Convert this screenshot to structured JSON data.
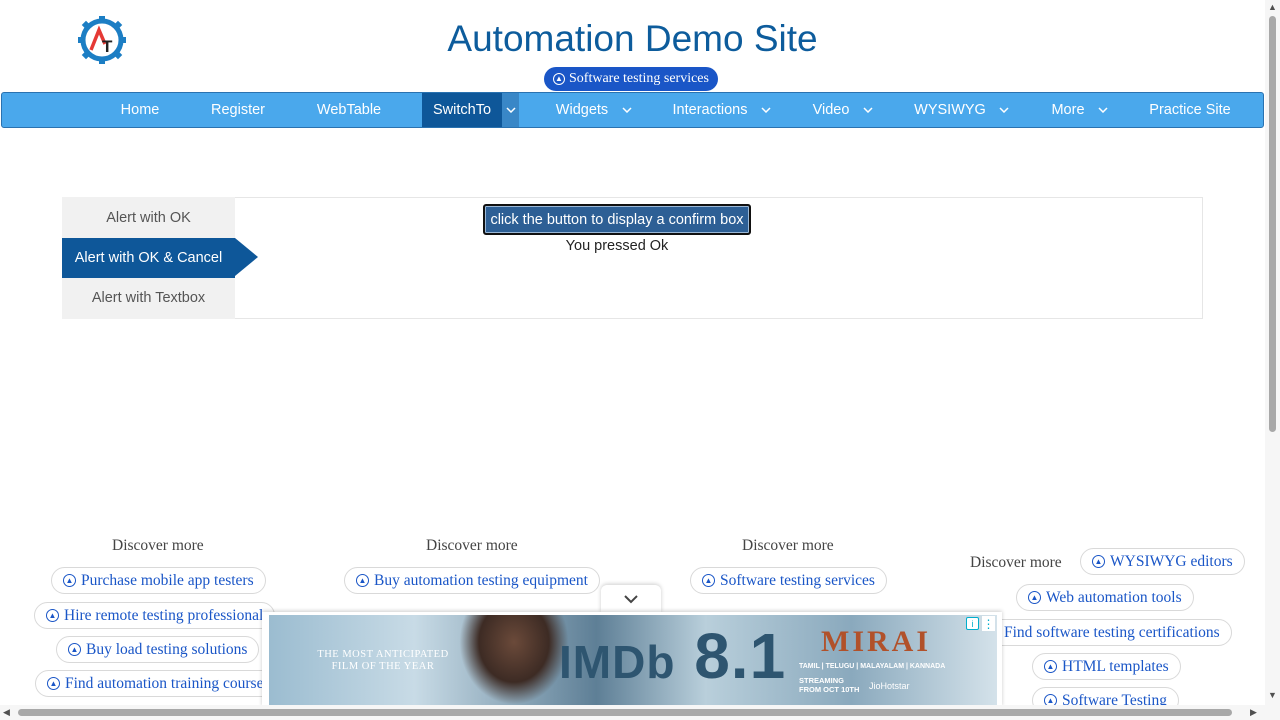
{
  "header": {
    "title": "Automation Demo Site",
    "services_pill": "Software testing services",
    "logo_letters": "AT"
  },
  "nav": {
    "items": [
      {
        "label": "Home",
        "has_dropdown": false,
        "active": false
      },
      {
        "label": "Register",
        "has_dropdown": false,
        "active": false
      },
      {
        "label": "WebTable",
        "has_dropdown": false,
        "active": false
      },
      {
        "label": "SwitchTo",
        "has_dropdown": true,
        "active": true
      },
      {
        "label": "Widgets",
        "has_dropdown": true,
        "active": false
      },
      {
        "label": "Interactions",
        "has_dropdown": true,
        "active": false
      },
      {
        "label": "Video",
        "has_dropdown": true,
        "active": false
      },
      {
        "label": "WYSIWYG",
        "has_dropdown": true,
        "active": false
      },
      {
        "label": "More",
        "has_dropdown": true,
        "active": false
      },
      {
        "label": "Practice Site",
        "has_dropdown": false,
        "active": false
      }
    ]
  },
  "alerts": {
    "tabs": [
      {
        "label": "Alert with OK",
        "active": false
      },
      {
        "label": "Alert with OK & Cancel",
        "active": true
      },
      {
        "label": "Alert with Textbox",
        "active": false
      }
    ],
    "confirm_button": "click the button to display a confirm box",
    "result_text": "You pressed Ok"
  },
  "discover": {
    "title": "Discover more",
    "col1": [
      "Purchase mobile app testers",
      "Hire remote testing professional",
      "Buy load testing solutions",
      "Find automation training course"
    ],
    "col2": [
      "Buy automation testing equipment"
    ],
    "col3": [
      "Software testing services"
    ],
    "col4": [
      "WYSIWYG editors",
      "Web automation tools",
      "Find software testing certifications",
      "HTML templates",
      "Software Testing"
    ]
  },
  "ad": {
    "tagline": "THE MOST ANTICIPATED FILM OF THE YEAR",
    "imdb_label": "IMDb",
    "rating": "8.1",
    "movie": "MIRAI",
    "languages": "TAMIL | TELUGU | MALAYALAM | KANNADA",
    "streaming": "STREAMING FROM OCT 10TH",
    "platform": "JioHotstar",
    "info_icon": "i",
    "close_icon": "⋮"
  },
  "colors": {
    "nav_bg": "#4aa8ec",
    "nav_active": "#0e5799",
    "title": "#0d5c9c",
    "link": "#1a56c7"
  }
}
